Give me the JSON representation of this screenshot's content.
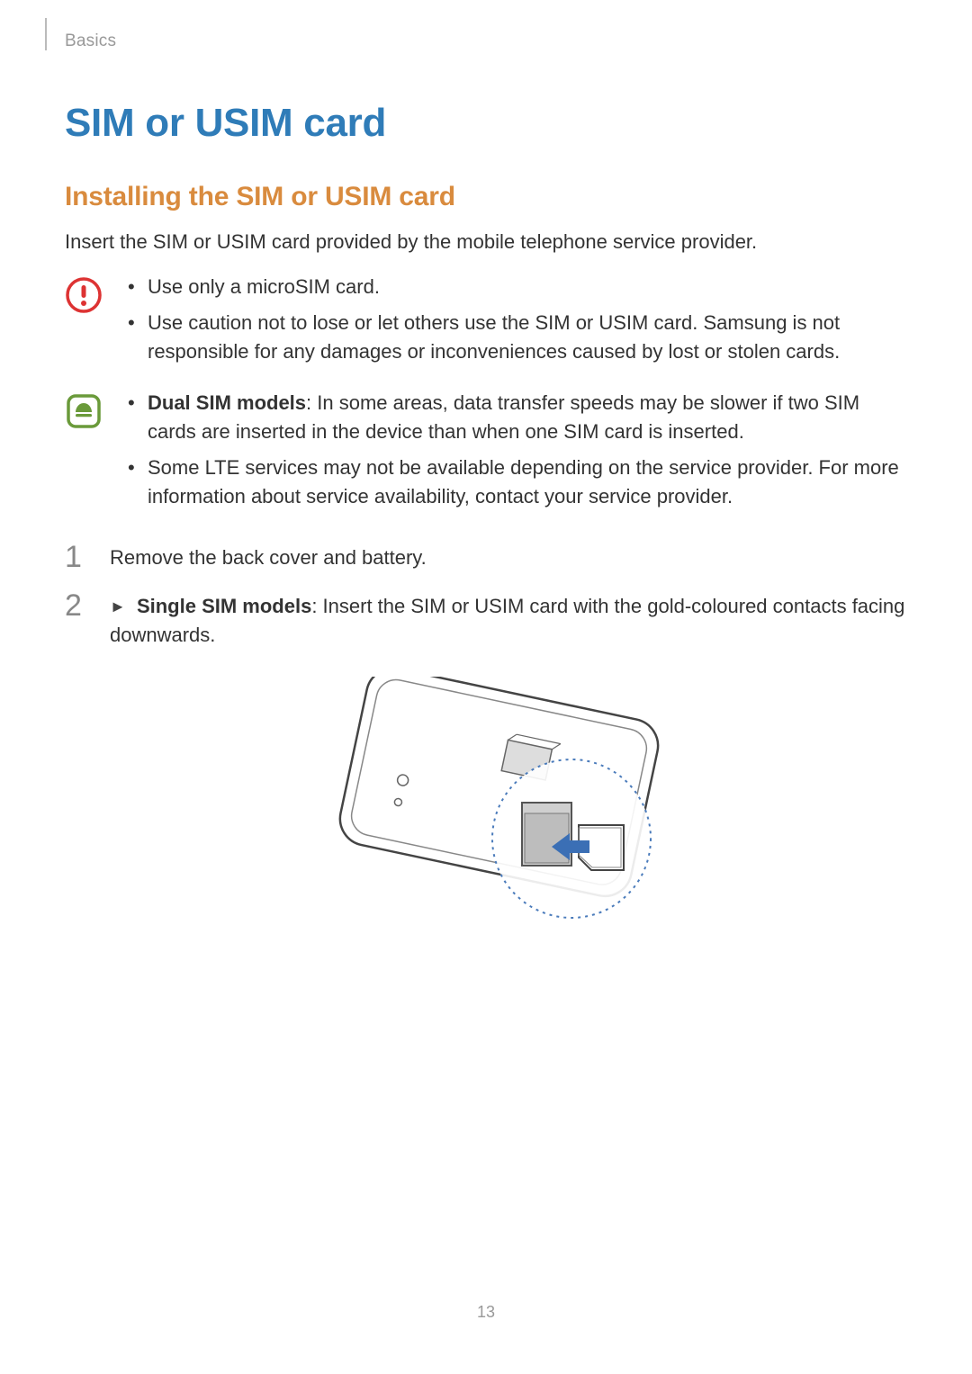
{
  "header": {
    "section": "Basics"
  },
  "title": "SIM or USIM card",
  "subtitle": "Installing the SIM or USIM card",
  "intro": "Insert the SIM or USIM card provided by the mobile telephone service provider.",
  "caution": {
    "items": [
      "Use only a microSIM card.",
      "Use caution not to lose or let others use the SIM or USIM card. Samsung is not responsible for any damages or inconveniences caused by lost or stolen cards."
    ]
  },
  "note": {
    "items": [
      {
        "bold": "Dual SIM models",
        "rest": ": In some areas, data transfer speeds may be slower if two SIM cards are inserted in the device than when one SIM card is inserted."
      },
      {
        "bold": "",
        "rest": "Some LTE services may not be available depending on the service provider. For more information about service availability, contact your service provider."
      }
    ]
  },
  "steps": [
    {
      "num": "1",
      "bold": "",
      "rest": "Remove the back cover and battery."
    },
    {
      "num": "2",
      "bold": "Single SIM models",
      "rest": ": Insert the SIM or USIM card with the gold-coloured contacts facing downwards."
    }
  ],
  "page_number": "13"
}
